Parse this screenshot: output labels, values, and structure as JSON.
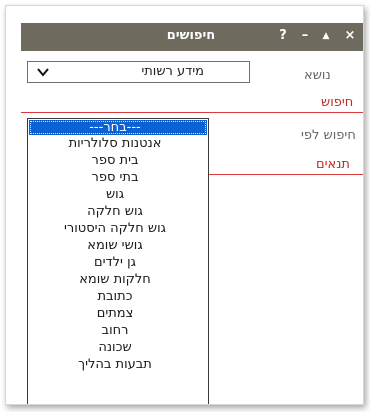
{
  "window": {
    "title": "חיפושים",
    "controls": {
      "close": "×",
      "minimize": "▲",
      "restore": "–",
      "help": "?"
    }
  },
  "subject": {
    "label": "נושא",
    "selected_value": "מידע רשותי",
    "chevron_icon": "chevron-down-icon"
  },
  "search_section": {
    "heading": "חיפוש"
  },
  "search_by": {
    "label": "חיפוש לפי"
  },
  "conditions_section": {
    "heading": "תנאים"
  },
  "dropdown": {
    "options": [
      "---בחר---",
      "אנטנות סלולריות",
      "בית ספר",
      "בתי ספר",
      "גוש",
      "גוש חלקה",
      "גוש חלקה היסטורי",
      "גושי שומא",
      "גן ילדים",
      "חלקות שומא",
      "כתובת",
      "צמתים",
      "רחוב",
      "שכונה",
      "תבעות בהליך"
    ],
    "selected_index": 0
  },
  "colors": {
    "titlebar": "#6e6b5e",
    "accent_red": "#c62828",
    "selection_blue": "#0a62d6"
  }
}
